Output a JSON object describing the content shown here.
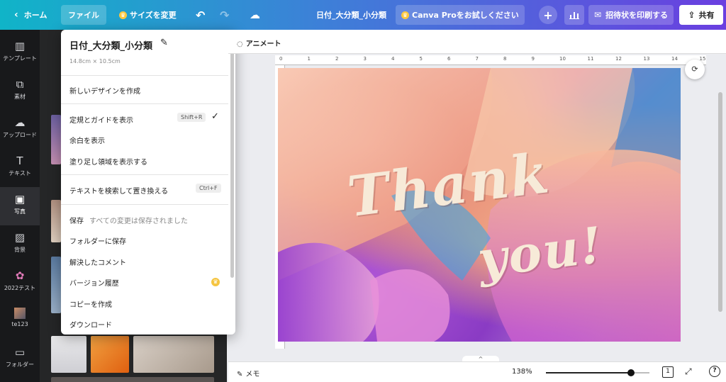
{
  "topbar": {
    "home_label": "ホーム",
    "file_label": "ファイル",
    "resize_label": "サイズを変更",
    "doc_title": "日付_大分類_小分類",
    "pro_label": "Canva Proをお試しください",
    "print_label": "招待状を印刷する",
    "share_label": "共有",
    "icons": [
      "chevron-left-icon",
      "crown-icon",
      "undo-icon",
      "redo-icon",
      "cloud-check-icon",
      "plus-icon",
      "bar-chart-icon",
      "envelope-icon",
      "share-upload-icon"
    ]
  },
  "sidebar": {
    "items": [
      {
        "label": "テンプレート",
        "icon": "template-icon"
      },
      {
        "label": "素材",
        "icon": "elements-icon"
      },
      {
        "label": "アップロード",
        "icon": "upload-icon"
      },
      {
        "label": "テキスト",
        "icon": "text-icon"
      },
      {
        "label": "写真",
        "icon": "photo-icon",
        "active": true
      },
      {
        "label": "背景",
        "icon": "background-icon"
      },
      {
        "label": "2022テスト",
        "icon": "flower-icon"
      },
      {
        "label": "te123",
        "icon": "folder-thumb-icon"
      },
      {
        "label": "フォルダー",
        "icon": "folder-icon"
      }
    ]
  },
  "file_menu": {
    "title": "日付_大分類_小分類",
    "size": "14.8cm × 10.5cm",
    "new_design": "新しいデザインを作成",
    "show_rulers": "定規とガイドを表示",
    "show_rulers_shortcut": "Shift+R",
    "show_margins": "余白を表示",
    "show_bleed": "塗り足し領域を表示する",
    "find_replace": "テキストを検索して置き換える",
    "find_replace_shortcut": "Ctrl+F",
    "save": "保存",
    "save_status": "すべての変更は保存されました",
    "save_to_folder": "フォルダーに保存",
    "resolved_comments": "解決したコメント",
    "version_history": "バージョン履歴",
    "make_copy": "コピーを作成",
    "download": "ダウンロード"
  },
  "context_bar": {
    "animate_label": "アニメート"
  },
  "ruler": {
    "ticks": [
      "0",
      "1",
      "2",
      "3",
      "4",
      "5",
      "6",
      "7",
      "8",
      "9",
      "10",
      "11",
      "12",
      "13",
      "14",
      "15"
    ]
  },
  "canvas": {
    "line1": "Thank",
    "line2": "you!"
  },
  "bottom_bar": {
    "notes_label": "メモ",
    "zoom_label": "138%",
    "zoom_fraction": 0.82,
    "page_number": "1",
    "help_label": "?"
  },
  "colors": {
    "topbar_start": "#10b4c8",
    "topbar_end": "#6a3fe0",
    "rail_bg": "#18191b",
    "panel_bg": "#252627",
    "text_color": "#f7ead8"
  }
}
